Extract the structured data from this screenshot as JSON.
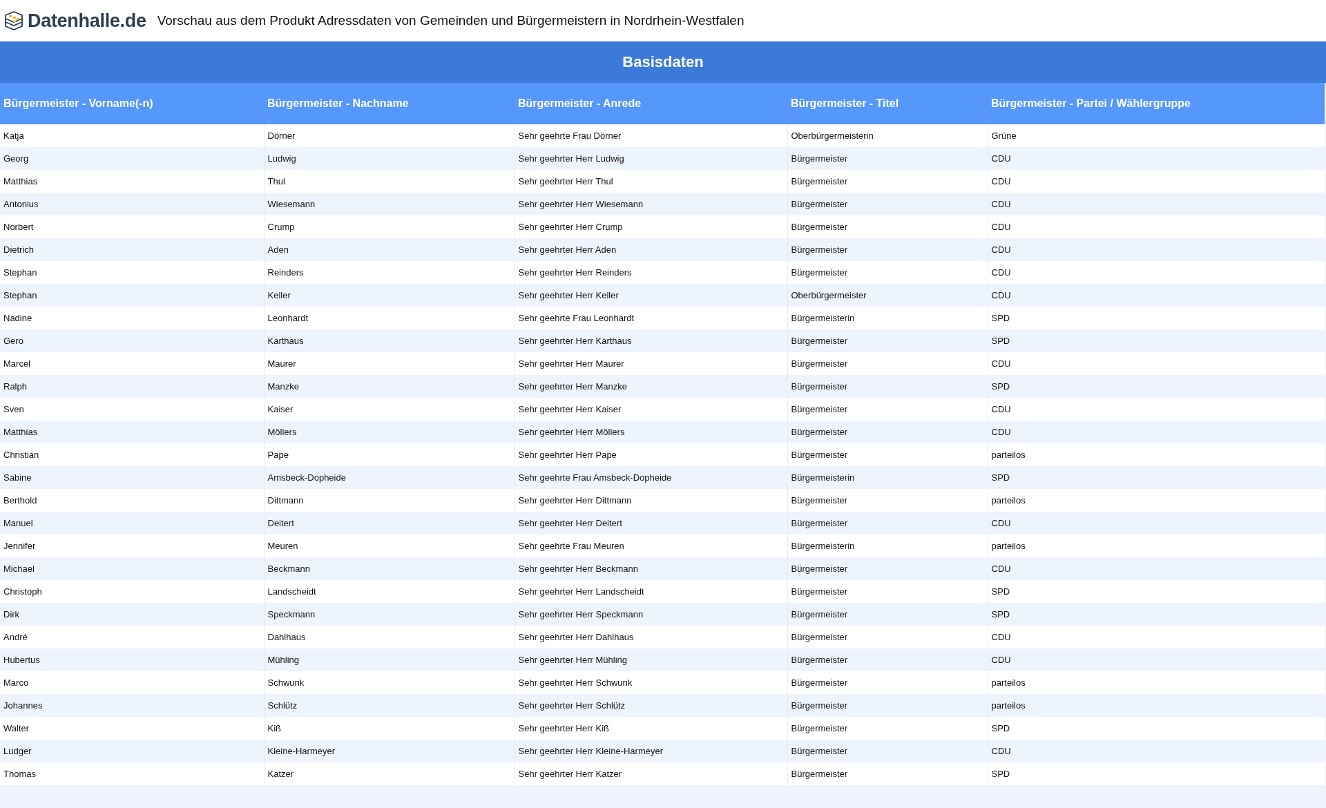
{
  "header": {
    "logo_text": "Datenhalle.de",
    "title": "Vorschau aus dem Produkt Adressdaten von Gemeinden und Bürgermeistern in Nordrhein-Westfalen"
  },
  "table": {
    "caption": "Basisdaten",
    "columns": [
      "Bürgermeister - Vorname(-n)",
      "Bürgermeister - Nachname",
      "Bürgermeister - Anrede",
      "Bürgermeister - Titel",
      "Bürgermeister - Partei / Wählergruppe"
    ],
    "rows": [
      [
        "Katja",
        "Dörner",
        "Sehr geehrte Frau Dörner",
        "Oberbürgermeisterin",
        "Grüne"
      ],
      [
        "Georg",
        "Ludwig",
        "Sehr geehrter Herr Ludwig",
        "Bürgermeister",
        "CDU"
      ],
      [
        "Matthias",
        "Thul",
        "Sehr geehrter Herr Thul",
        "Bürgermeister",
        "CDU"
      ],
      [
        "Antonius",
        "Wiesemann",
        "Sehr geehrter Herr Wiesemann",
        "Bürgermeister",
        "CDU"
      ],
      [
        "Norbert",
        "Crump",
        "Sehr geehrter Herr Crump",
        "Bürgermeister",
        "CDU"
      ],
      [
        "Dietrich",
        "Aden",
        "Sehr geehrter Herr Aden",
        "Bürgermeister",
        "CDU"
      ],
      [
        "Stephan",
        "Reinders",
        "Sehr geehrter Herr Reinders",
        "Bürgermeister",
        "CDU"
      ],
      [
        "Stephan",
        "Keller",
        "Sehr geehrter Herr Keller",
        "Oberbürgermeister",
        "CDU"
      ],
      [
        "Nadine",
        "Leonhardt",
        "Sehr geehrte Frau Leonhardt",
        "Bürgermeisterin",
        "SPD"
      ],
      [
        "Gero",
        "Karthaus",
        "Sehr geehrter Herr Karthaus",
        "Bürgermeister",
        "SPD"
      ],
      [
        "Marcel",
        "Maurer",
        "Sehr geehrter Herr Maurer",
        "Bürgermeister",
        "CDU"
      ],
      [
        "Ralph",
        "Manzke",
        "Sehr geehrter Herr Manzke",
        "Bürgermeister",
        "SPD"
      ],
      [
        "Sven",
        "Kaiser",
        "Sehr geehrter Herr Kaiser",
        "Bürgermeister",
        "CDU"
      ],
      [
        "Matthias",
        "Möllers",
        "Sehr geehrter Herr Möllers",
        "Bürgermeister",
        "CDU"
      ],
      [
        "Christian",
        "Pape",
        "Sehr geehrter Herr Pape",
        "Bürgermeister",
        "parteilos"
      ],
      [
        "Sabine",
        "Amsbeck-Dopheide",
        "Sehr geehrte Frau Amsbeck-Dopheide",
        "Bürgermeisterin",
        "SPD"
      ],
      [
        "Berthold",
        "Dittmann",
        "Sehr geehrter Herr Dittmann",
        "Bürgermeister",
        "parteilos"
      ],
      [
        "Manuel",
        "Deitert",
        "Sehr geehrter Herr Deitert",
        "Bürgermeister",
        "CDU"
      ],
      [
        "Jennifer",
        "Meuren",
        "Sehr geehrte Frau Meuren",
        "Bürgermeisterin",
        "parteilos"
      ],
      [
        "Michael",
        "Beckmann",
        "Sehr geehrter Herr Beckmann",
        "Bürgermeister",
        "CDU"
      ],
      [
        "Christoph",
        "Landscheidt",
        "Sehr geehrter Herr Landscheidt",
        "Bürgermeister",
        "SPD"
      ],
      [
        "Dirk",
        "Speckmann",
        "Sehr geehrter Herr Speckmann",
        "Bürgermeister",
        "SPD"
      ],
      [
        "André",
        "Dahlhaus",
        "Sehr geehrter Herr Dahlhaus",
        "Bürgermeister",
        "CDU"
      ],
      [
        "Hubertus",
        "Mühling",
        "Sehr geehrter Herr Mühling",
        "Bürgermeister",
        "CDU"
      ],
      [
        "Marco",
        "Schwunk",
        "Sehr geehrter Herr Schwunk",
        "Bürgermeister",
        "parteilos"
      ],
      [
        "Johannes",
        "Schlütz",
        "Sehr geehrter Herr Schlütz",
        "Bürgermeister",
        "parteilos"
      ],
      [
        "Walter",
        "Kiß",
        "Sehr geehrter Herr Kiß",
        "Bürgermeister",
        "SPD"
      ],
      [
        "Ludger",
        "Kleine-Harmeyer",
        "Sehr geehrter Herr Kleine-Harmeyer",
        "Bürgermeister",
        "CDU"
      ],
      [
        "Thomas",
        "Katzer",
        "Sehr geehrter Herr Katzer",
        "Bürgermeister",
        "SPD"
      ]
    ]
  }
}
